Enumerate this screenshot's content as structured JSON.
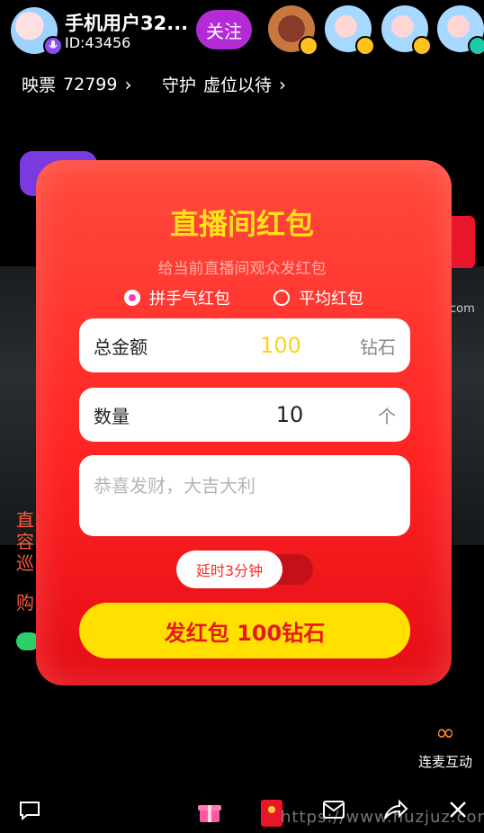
{
  "header": {
    "host_name": "手机用户32...",
    "host_id": "ID:43456",
    "follow_label": "关注",
    "viewers": [
      "viewer-food",
      "viewer-mouse",
      "viewer-mouse",
      "viewer-mouse"
    ]
  },
  "stats": {
    "ticket_label": "映票",
    "ticket_value": "72799",
    "guard_label": "守护",
    "guard_value": "虚位以待"
  },
  "background": {
    "side_text_lines": [
      "直",
      "容",
      "巡"
    ],
    "side_buy": "购",
    "side_com": "com"
  },
  "redpacket_modal": {
    "title": "直播间红包",
    "subtitle": "给当前直播间观众发红包",
    "type_options": [
      {
        "label": "拼手气红包",
        "selected": true
      },
      {
        "label": "平均红包",
        "selected": false
      }
    ],
    "total": {
      "label": "总金额",
      "value": "100",
      "unit": "钻石"
    },
    "quantity": {
      "label": "数量",
      "value": "10",
      "unit": "个"
    },
    "message_placeholder": "恭喜发财，大吉大利",
    "delay_label": "延时3分钟",
    "send_label": "发红包 100钻石"
  },
  "bottom": {
    "lianmai_label": "连麦互动",
    "icons": [
      "chat-icon",
      "gift-icon",
      "redpacket-icon",
      "mail-icon",
      "share-icon",
      "close-icon"
    ]
  },
  "watermark": "https://www.huzjuz.com",
  "colors": {
    "accent_yellow": "#ffe000",
    "modal_red": "#ff2525",
    "follow_purple": "#b42ad6"
  }
}
